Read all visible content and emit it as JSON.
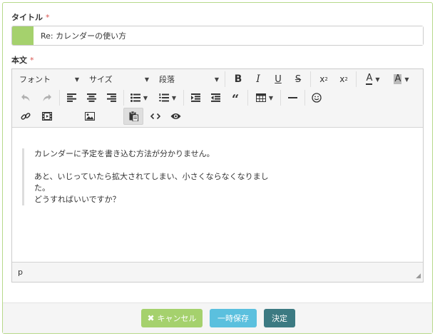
{
  "form": {
    "title_label": "タイトル",
    "body_label": "本文",
    "required_mark": "*",
    "title_value": "Re: カレンダーの使い方"
  },
  "toolbar": {
    "font": "フォント",
    "size": "サイズ",
    "paragraph": "段落",
    "bold": "B",
    "italic": "I",
    "underline": "U",
    "strike": "S",
    "subscript_base": "x",
    "subscript_mark": "2",
    "superscript_base": "x",
    "superscript_mark": "2",
    "text_color": "A",
    "bg_color": "A"
  },
  "content": {
    "lines": [
      "カレンダーに予定を書き込む方法が分かりません。",
      "あと、いじっていたら拡大されてしまい、小さくならなくなりました。",
      "どうすればいいですか？"
    ]
  },
  "statusbar": {
    "path": "p"
  },
  "footer": {
    "cancel_label": "キャンセル",
    "draft_label": "一時保存",
    "submit_label": "決定"
  },
  "colors": {
    "accent_green": "#a5d16d",
    "info_blue": "#5bc0de",
    "primary_teal": "#3c7a82",
    "frame_border": "#b6d98a",
    "required_red": "#d9534f"
  }
}
